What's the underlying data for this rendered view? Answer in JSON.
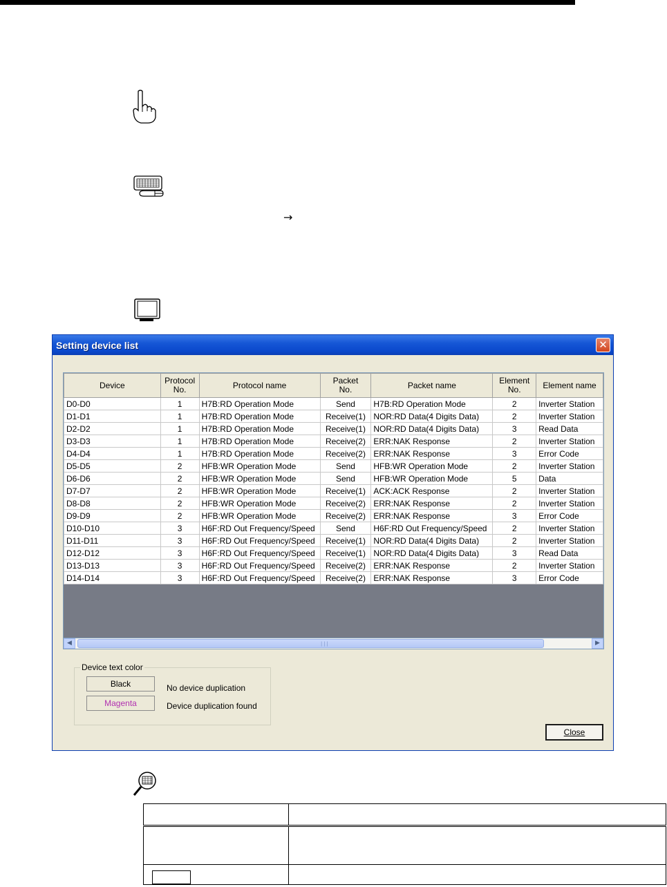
{
  "dialog": {
    "title": "Setting device list",
    "close_glyph": "✕",
    "columns": [
      "Device",
      "Protocol\nNo.",
      "Protocol name",
      "Packet\nNo.",
      "Packet name",
      "Element\nNo.",
      "Element name"
    ],
    "rows": [
      [
        "D0-D0",
        "1",
        "H7B:RD Operation Mode",
        "Send",
        "H7B:RD Operation Mode",
        "2",
        "Inverter Station"
      ],
      [
        "D1-D1",
        "1",
        "H7B:RD Operation Mode",
        "Receive(1)",
        "NOR:RD Data(4 Digits Data)",
        "2",
        "Inverter Station"
      ],
      [
        "D2-D2",
        "1",
        "H7B:RD Operation Mode",
        "Receive(1)",
        "NOR:RD Data(4 Digits Data)",
        "3",
        "Read Data"
      ],
      [
        "D3-D3",
        "1",
        "H7B:RD Operation Mode",
        "Receive(2)",
        "ERR:NAK Response",
        "2",
        "Inverter Station"
      ],
      [
        "D4-D4",
        "1",
        "H7B:RD Operation Mode",
        "Receive(2)",
        "ERR:NAK Response",
        "3",
        "Error Code"
      ],
      [
        "D5-D5",
        "2",
        "HFB:WR Operation Mode",
        "Send",
        "HFB:WR Operation Mode",
        "2",
        "Inverter Station"
      ],
      [
        "D6-D6",
        "2",
        "HFB:WR Operation Mode",
        "Send",
        "HFB:WR Operation Mode",
        "5",
        "Data"
      ],
      [
        "D7-D7",
        "2",
        "HFB:WR Operation Mode",
        "Receive(1)",
        "ACK:ACK Response",
        "2",
        "Inverter Station"
      ],
      [
        "D8-D8",
        "2",
        "HFB:WR Operation Mode",
        "Receive(2)",
        "ERR:NAK Response",
        "2",
        "Inverter Station"
      ],
      [
        "D9-D9",
        "2",
        "HFB:WR Operation Mode",
        "Receive(2)",
        "ERR:NAK Response",
        "3",
        "Error Code"
      ],
      [
        "D10-D10",
        "3",
        "H6F:RD Out Frequency/Speed",
        "Send",
        "H6F:RD Out Frequency/Speed",
        "2",
        "Inverter Station"
      ],
      [
        "D11-D11",
        "3",
        "H6F:RD Out Frequency/Speed",
        "Receive(1)",
        "NOR:RD Data(4 Digits Data)",
        "2",
        "Inverter Station"
      ],
      [
        "D12-D12",
        "3",
        "H6F:RD Out Frequency/Speed",
        "Receive(1)",
        "NOR:RD Data(4 Digits Data)",
        "3",
        "Read Data"
      ],
      [
        "D13-D13",
        "3",
        "H6F:RD Out Frequency/Speed",
        "Receive(2)",
        "ERR:NAK Response",
        "2",
        "Inverter Station"
      ],
      [
        "D14-D14",
        "3",
        "H6F:RD Out Frequency/Speed",
        "Receive(2)",
        "ERR:NAK Response",
        "3",
        "Error Code"
      ]
    ],
    "legend": {
      "title": "Device text color",
      "items": [
        {
          "swatch": "Black",
          "color": "#000000",
          "description": "No device duplication"
        },
        {
          "swatch": "Magenta",
          "color": "#b030b0",
          "description": "Device duplication found"
        }
      ]
    },
    "close_button": "Close",
    "scroll_left_glyph": "◀",
    "scroll_right_glyph": "▶"
  },
  "page": {
    "arrow": "→"
  },
  "icons": [
    "pointing-hand-icon",
    "keyboard-icon",
    "monitor-icon",
    "magnifier-icon"
  ]
}
